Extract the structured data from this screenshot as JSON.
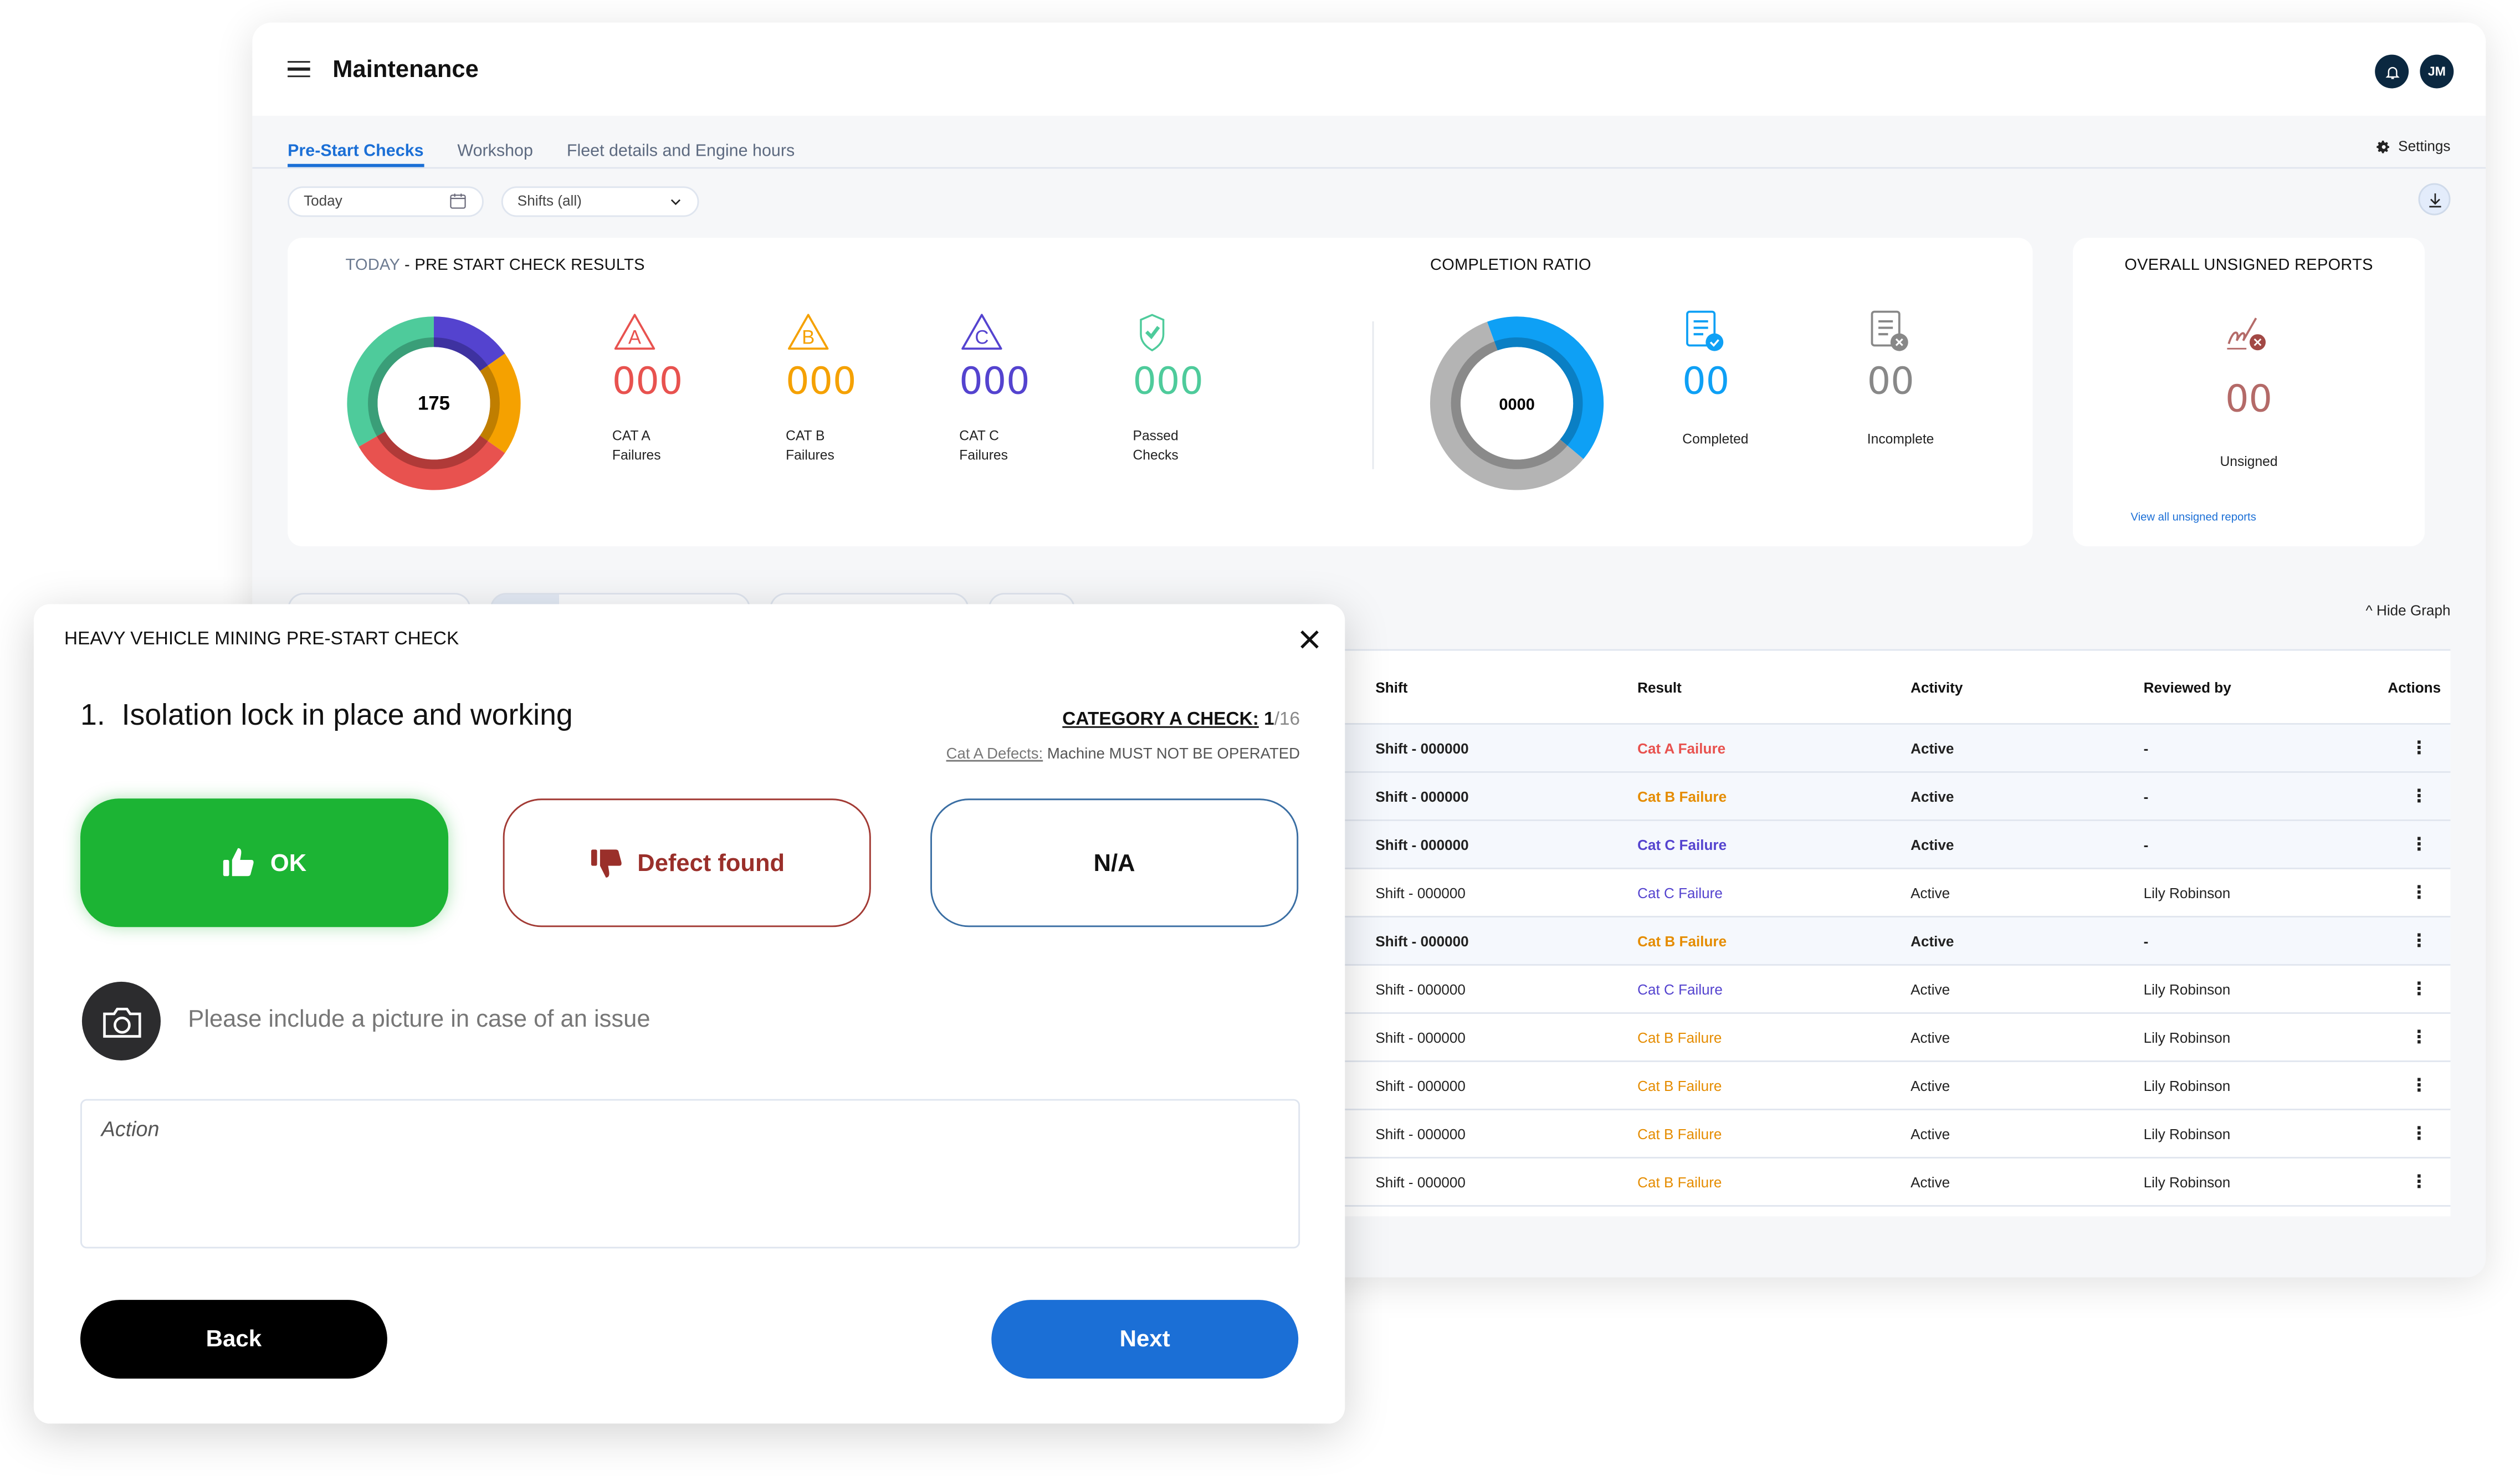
{
  "header": {
    "title": "Maintenance",
    "notifications_icon": "bell-icon",
    "avatar_initials": "JM"
  },
  "tabs": [
    {
      "label": "Pre-Start Checks",
      "active": true
    },
    {
      "label": "Workshop",
      "active": false
    },
    {
      "label": "Fleet details and Engine hours",
      "active": false
    }
  ],
  "settings_label": "Settings",
  "filters": {
    "date_value": "Today",
    "shift_value": "Shifts (all)"
  },
  "results_card": {
    "title_prefix": "TODAY",
    "title_rest": " - PRE START CHECK RESULTS",
    "donut_total": "175",
    "stats": [
      {
        "icon_letter": "A",
        "value": "000",
        "label1": "CAT A",
        "label2": "Failures",
        "color": "#e8524f"
      },
      {
        "icon_letter": "B",
        "value": "000",
        "label1": "CAT B",
        "label2": "Failures",
        "color": "#f5a100"
      },
      {
        "icon_letter": "C",
        "value": "000",
        "label1": "CAT C",
        "label2": "Failures",
        "color": "#5443cf"
      },
      {
        "icon_letter": "",
        "value": "000",
        "label1": "Passed",
        "label2": "Checks",
        "color": "#4ecb9b"
      }
    ]
  },
  "completion_card": {
    "title": "COMPLETION RATIO",
    "donut_center": "0000",
    "stats": [
      {
        "value": "00",
        "label": "Completed",
        "color": "#0ea0f5"
      },
      {
        "value": "00",
        "label": "Incomplete",
        "color": "#888888"
      }
    ]
  },
  "unsigned_card": {
    "title": "OVERALL UNSIGNED REPORTS",
    "value": "00",
    "label": "Unsigned",
    "link": "View all unsigned reports",
    "color": "#b46a68"
  },
  "hide_graph_label": "Hide Graph",
  "table": {
    "columns": [
      "Shift",
      "Result",
      "Activity",
      "Reviewed by",
      "Actions"
    ],
    "rows": [
      {
        "shift": "Shift - 000000",
        "result": "Cat A Failure",
        "result_color": "#e8524f",
        "activity": "Active",
        "reviewed_by": "-",
        "pending": true
      },
      {
        "shift": "Shift - 000000",
        "result": "Cat B Failure",
        "result_color": "#e58c00",
        "activity": "Active",
        "reviewed_by": "-",
        "pending": true
      },
      {
        "shift": "Shift - 000000",
        "result": "Cat C Failure",
        "result_color": "#5443cf",
        "activity": "Active",
        "reviewed_by": "-",
        "pending": true
      },
      {
        "shift": "Shift - 000000",
        "result": "Cat C Failure",
        "result_color": "#5443cf",
        "activity": "Active",
        "reviewed_by": "Lily Robinson",
        "pending": false
      },
      {
        "shift": "Shift - 000000",
        "result": "Cat B Failure",
        "result_color": "#e58c00",
        "activity": "Active",
        "reviewed_by": "-",
        "pending": true
      },
      {
        "shift": "Shift - 000000",
        "result": "Cat C Failure",
        "result_color": "#5443cf",
        "activity": "Active",
        "reviewed_by": "Lily Robinson",
        "pending": false
      },
      {
        "shift": "Shift - 000000",
        "result": "Cat B Failure",
        "result_color": "#e58c00",
        "activity": "Active",
        "reviewed_by": "Lily Robinson",
        "pending": false
      },
      {
        "shift": "Shift - 000000",
        "result": "Cat B Failure",
        "result_color": "#e58c00",
        "activity": "Active",
        "reviewed_by": "Lily Robinson",
        "pending": false
      },
      {
        "shift": "Shift - 000000",
        "result": "Cat B Failure",
        "result_color": "#e58c00",
        "activity": "Active",
        "reviewed_by": "Lily Robinson",
        "pending": false
      },
      {
        "shift": "Shift - 000000",
        "result": "Cat B Failure",
        "result_color": "#e58c00",
        "activity": "Active",
        "reviewed_by": "Lily Robinson",
        "pending": false
      }
    ]
  },
  "modal": {
    "title": "HEAVY VEHICLE MINING PRE-START CHECK",
    "question_number": "1.",
    "question": "Isolation lock in place and working",
    "category_label": "CATEGORY A CHECK:",
    "category_current": "1",
    "category_total": "/16",
    "note_label": "Cat A Defects:",
    "note_text": " Machine MUST NOT BE OPERATED",
    "ok_label": "OK",
    "defect_label": "Defect found",
    "na_label": "N/A",
    "photo_prompt": "Please include a picture in case of an issue",
    "action_placeholder": "Action",
    "back_label": "Back",
    "next_label": "Next"
  }
}
